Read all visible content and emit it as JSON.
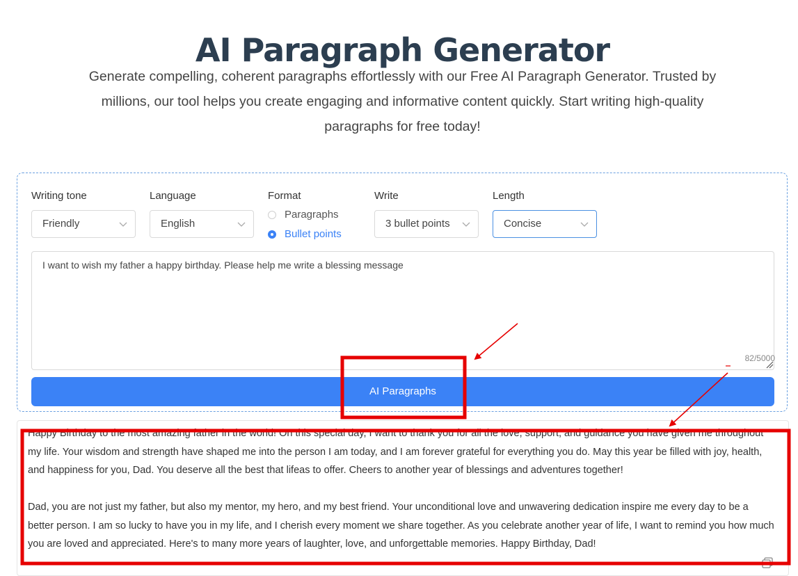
{
  "page": {
    "title": "AI Paragraph Generator",
    "subtitle": "Generate compelling, coherent paragraphs effortlessly with our Free AI Paragraph Generator. Trusted by millions, our tool helps you create engaging and informative content quickly. Start writing high-quality paragraphs for free today!"
  },
  "form": {
    "tone": {
      "label": "Writing tone",
      "value": "Friendly"
    },
    "language": {
      "label": "Language",
      "value": "English"
    },
    "format": {
      "label": "Format",
      "options": [
        "Paragraphs",
        "Bullet points"
      ],
      "selected": "Bullet points"
    },
    "write": {
      "label": "Write",
      "value": "3 bullet points"
    },
    "length": {
      "label": "Length",
      "value": "Concise"
    },
    "prompt": "I want to wish my father a happy birthday. Please help me write a blessing message",
    "char_count": "82/5000",
    "button_label": "AI Paragraphs"
  },
  "output": {
    "paragraphs": [
      "Happy Birthday to the most amazing father in the world! On this special day, I want to thank you for all the love, support, and guidance you have given me throughout my life. Your wisdom and strength have shaped me into the person I am today, and I am forever grateful for everything you do. May this year be filled with joy, health, and happiness for you, Dad. You deserve all the best that lifeas to offer. Cheers to another year of blessings and adventures together!",
      "Dad, you are not just my father, but also my mentor, my hero, and my best friend. Your unconditional love and unwavering dedication inspire me every day to be a better person. I am so lucky to have you in my life, and I cherish every moment we share together. As you celebrate another year of life, I want to remind you how much you are loved and appreciated. Here's to many more years of laughter, love, and unforgettable memories. Happy Birthday, Dad!"
    ]
  },
  "colors": {
    "accent": "#3b82f6",
    "annotation": "#e60000",
    "title": "#2c3e50"
  }
}
